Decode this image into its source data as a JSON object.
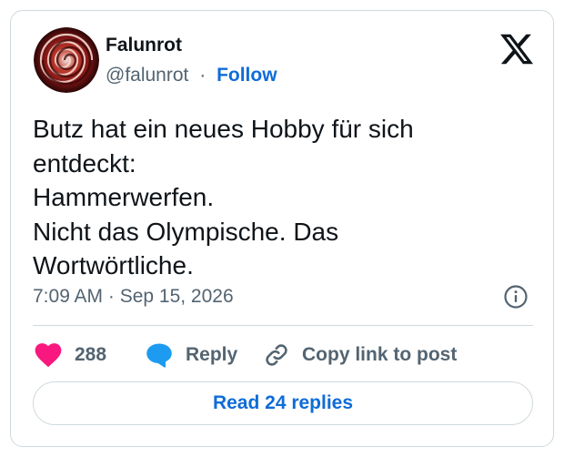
{
  "author": {
    "name": "Falunrot",
    "handle": "@falunrot",
    "separator": "·",
    "follow_label": "Follow"
  },
  "tweet": {
    "lines": [
      "Butz hat ein neues Hobby für sich",
      "entdeckt:",
      "Hammerwerfen.",
      "Nicht das Olympische. Das",
      "Wortwörtliche."
    ],
    "timestamp": "7:09 AM · Sep 15, 2026"
  },
  "actions": {
    "likes_count": "288",
    "reply_label": "Reply",
    "copy_label": "Copy link to post"
  },
  "read_replies_label": "Read 24 replies",
  "icons": {
    "like": "heart-icon",
    "reply": "speech-bubble-icon",
    "copy": "link-icon",
    "info": "info-icon",
    "brand": "x-logo-icon"
  },
  "colors": {
    "like": "#f91880",
    "reply": "#1d9bf0",
    "link": "#0f6cd8",
    "muted": "#536471",
    "border": "#cfd9de"
  }
}
